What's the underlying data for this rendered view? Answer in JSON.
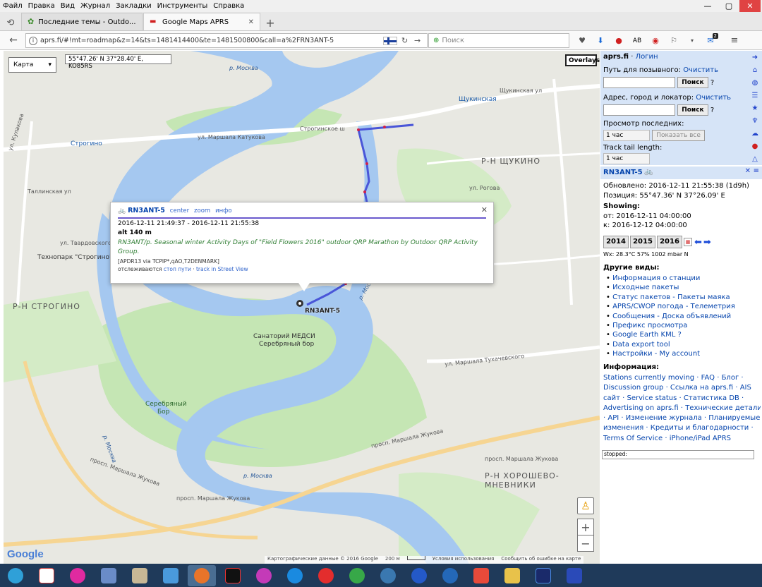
{
  "menubar": {
    "items": [
      "Файл",
      "Правка",
      "Вид",
      "Журнал",
      "Закладки",
      "Инструменты",
      "Справка"
    ]
  },
  "tabs": [
    {
      "title": "Последние темы - Outdo...",
      "icon": "leaf-icon"
    },
    {
      "title": "Google Maps APRS",
      "icon": "car-icon"
    }
  ],
  "navbar": {
    "url": "aprs.fi/#!mt=roadmap&z=14&ts=1481414400&te=1481500800&call=a%2FRN3ANT-5",
    "search_placeholder": "Поиск",
    "badge": "2",
    "ab": "AB"
  },
  "map": {
    "type_label": "Карта",
    "coords": "55°47.26' N 37°28.40' E, KO85RS",
    "overlays_label": "Overlays",
    "station_label": "RN3ANT-5",
    "labels": {
      "moskva_river": "р. Москва",
      "moskva_river2": "р. Москва",
      "moskva_river3": "р. Москва",
      "moskva_river4": "р. Москва",
      "strogino": "Р-Н СТРОГИНО",
      "shchukino": "Р-Н ЩУКИНО",
      "khoroshevo": "Р-Н ХОРОШЕВО-МНЕВНИКИ",
      "sanatorium": "Санаторий МЕДСИ",
      "serebryany_bor": "Серебряный бор",
      "serebryany_bor_forest1": "Серебряный",
      "serebryany_bor_forest2": "Бор",
      "technopark": "Технопарк \"Строгино\"",
      "strogino_metro": "Строгино",
      "shchukinskaya_metro": "Щукинская",
      "stroginskoe_sh": "Строгинское ш",
      "marshala_katukova": "ул. Маршала Катукова",
      "zhukova1": "просп. Маршала Жукова",
      "zhukova2": "просп. Маршала Жукова",
      "zhukova3": "просп. Маршала Жукова",
      "zhukova4": "просп. Маршала Жукова",
      "tukhachevskogo": "ул. Маршала Тухачевского",
      "shchukinskaya_ul": "Щукинская ул",
      "kulakova": "ул. Кулакова",
      "tallinskaya": "Таллинская ул",
      "tvardovskogo": "ул. Твардовского",
      "rogova": "ул. Рогова",
      "vorobev": "ул. Маршала Катукова"
    },
    "attribution": "Картографические данные © 2016 Google",
    "scale": "200 м",
    "terms": "Условия использования",
    "report": "Сообщить об ошибке на карте",
    "google": "Google",
    "zoom_in": "+",
    "zoom_out": "−"
  },
  "popup": {
    "callsign": "RN3ANT-5",
    "link_center": "center",
    "link_zoom": "zoom",
    "link_info": "инфо",
    "time_range": "2016-12-11 21:49:37 - 2016-12-11 21:55:38",
    "alt": "alt 140 m",
    "comment": "RN3ANT/p. Seasonal winter Activity Days of \"Field Flowers 2016\" outdoor QRP Marathon by Outdoor QRP Activity Group.",
    "path": "[APDR13 via TCPIP*,qAO,T2DENMARK]",
    "tracking_prefix": "отслеживаются",
    "tracking_link1": "стоп пути",
    "tracking_link2": "track in Street View"
  },
  "sidebar": {
    "site": "aprs.fi",
    "login": "Логин",
    "path_label": "Путь для позывного:",
    "clear1": "Очистить",
    "search_btn": "Поиск",
    "q": "?",
    "address_label": "Адрес, город и локатор:",
    "clear2": "Очистить",
    "search_btn2": "Поиск",
    "view_last": "Просмотр последних:",
    "period": "1 час",
    "show_all": "Показать все",
    "track_tail": "Track tail length:",
    "tail_value": "1 час",
    "station": "RN3ANT-5",
    "updated": "Обновлено: 2016-12-11 21:55:38 (1d9h)",
    "position": "Позиция: 55°47.36' N 37°26.09' E",
    "showing": "Showing:",
    "from": "от: 2016-12-11 04:00:00",
    "to": "к: 2016-12-12 04:00:00",
    "years": [
      "2014",
      "2015",
      "2016"
    ],
    "wx": "Wx: 28.3°C 57% 1002 mbar N",
    "other_views_title": "Другие виды:",
    "other_views": [
      "Информация о станции",
      "Исходные пакеты",
      "Статус пакетов - Пакеты маяка",
      "APRS/CWOP погода - Телеметрия",
      "Сообщения - Доска объявлений",
      "Префикс просмотра",
      "Google Earth KML ?",
      "Data export tool",
      "Настройки - My account"
    ],
    "info_title": "Информация:",
    "info_lines": [
      "Stations currently moving · FAQ · Блог ·",
      "Discussion group · Ссылка на aprs.fi · AIS",
      "сайт · Service status · Статистика DB ·",
      "Advertising on aprs.fi · Технические детали",
      "· API · Изменение журнала · Планируемые",
      "изменения · Кредиты и благодарности ·",
      "Terms Of Service · iPhone/iPad APRS"
    ],
    "status_box": "stopped:"
  },
  "colors": {
    "track": "#4a56d8",
    "track_marks": "#d0204a",
    "river": "#a5c8f0",
    "park": "#c5e6b4",
    "road_major": "#f6d592",
    "sidebar_blue": "#d6e4f7"
  }
}
